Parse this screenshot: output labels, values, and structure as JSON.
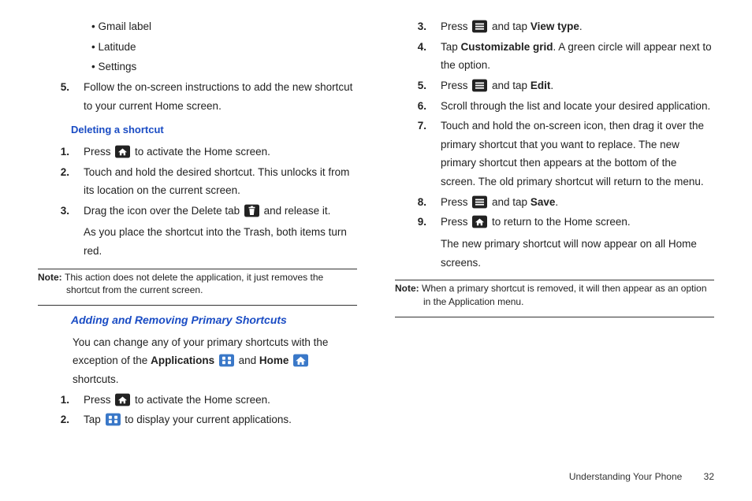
{
  "footer": {
    "section": "Understanding Your Phone",
    "page": "32"
  },
  "left": {
    "bullets": [
      "Gmail label",
      "Latitude",
      "Settings"
    ],
    "step5n": "5.",
    "step5t": "Follow the on-screen instructions to add the new shortcut to your current Home screen.",
    "h_del": "Deleting a shortcut",
    "d1n": "1.",
    "d1a": "Press ",
    "d1b": " to activate the Home screen.",
    "d2n": "2.",
    "d2t": "Touch and hold the desired shortcut. This unlocks it from its location on the current screen.",
    "d3n": "3.",
    "d3a": "Drag the icon over the Delete tab ",
    "d3b": " and release it.",
    "d3c": "As you place the shortcut into the Trash, both items turn red.",
    "note1_label": "Note: ",
    "note1": "This action does not delete the application, it just removes the shortcut from the current screen.",
    "h_add": "Adding and Removing Primary Shortcuts",
    "intro_a": "You can change any of your primary shortcuts with the exception of the ",
    "intro_apps": "Applications",
    "intro_b": " and ",
    "intro_home": "Home",
    "intro_c": " shortcuts.",
    "a1n": "1.",
    "a1a": "Press ",
    "a1b": " to activate the Home screen.",
    "a2n": "2.",
    "a2a": "Tap ",
    "a2b": " to display your current applications."
  },
  "right": {
    "r3n": "3.",
    "r3a": "Press ",
    "r3b": " and tap ",
    "r3c": "View type",
    "r3d": ".",
    "r4n": "4.",
    "r4a": "Tap ",
    "r4b": "Customizable grid",
    "r4c": ". A green circle will appear next to the option.",
    "r5n": "5.",
    "r5a": "Press ",
    "r5b": " and tap ",
    "r5c": "Edit",
    "r5d": ".",
    "r6n": "6.",
    "r6t": "Scroll through the list and locate your desired application.",
    "r7n": "7.",
    "r7t": "Touch and hold the on-screen icon, then drag it over the primary shortcut that you want to replace. The new primary shortcut then appears at the bottom of the screen. The old primary shortcut will return to the menu.",
    "r8n": "8.",
    "r8a": "Press ",
    "r8b": " and tap ",
    "r8c": "Save",
    "r8d": ".",
    "r9n": "9.",
    "r9a": "Press ",
    "r9b": " to return to the Home screen.",
    "r9c": "The new primary shortcut will now appear on all Home screens.",
    "note2_label": "Note: ",
    "note2": "When a primary shortcut is removed, it will then appear as an option in the Application menu."
  }
}
